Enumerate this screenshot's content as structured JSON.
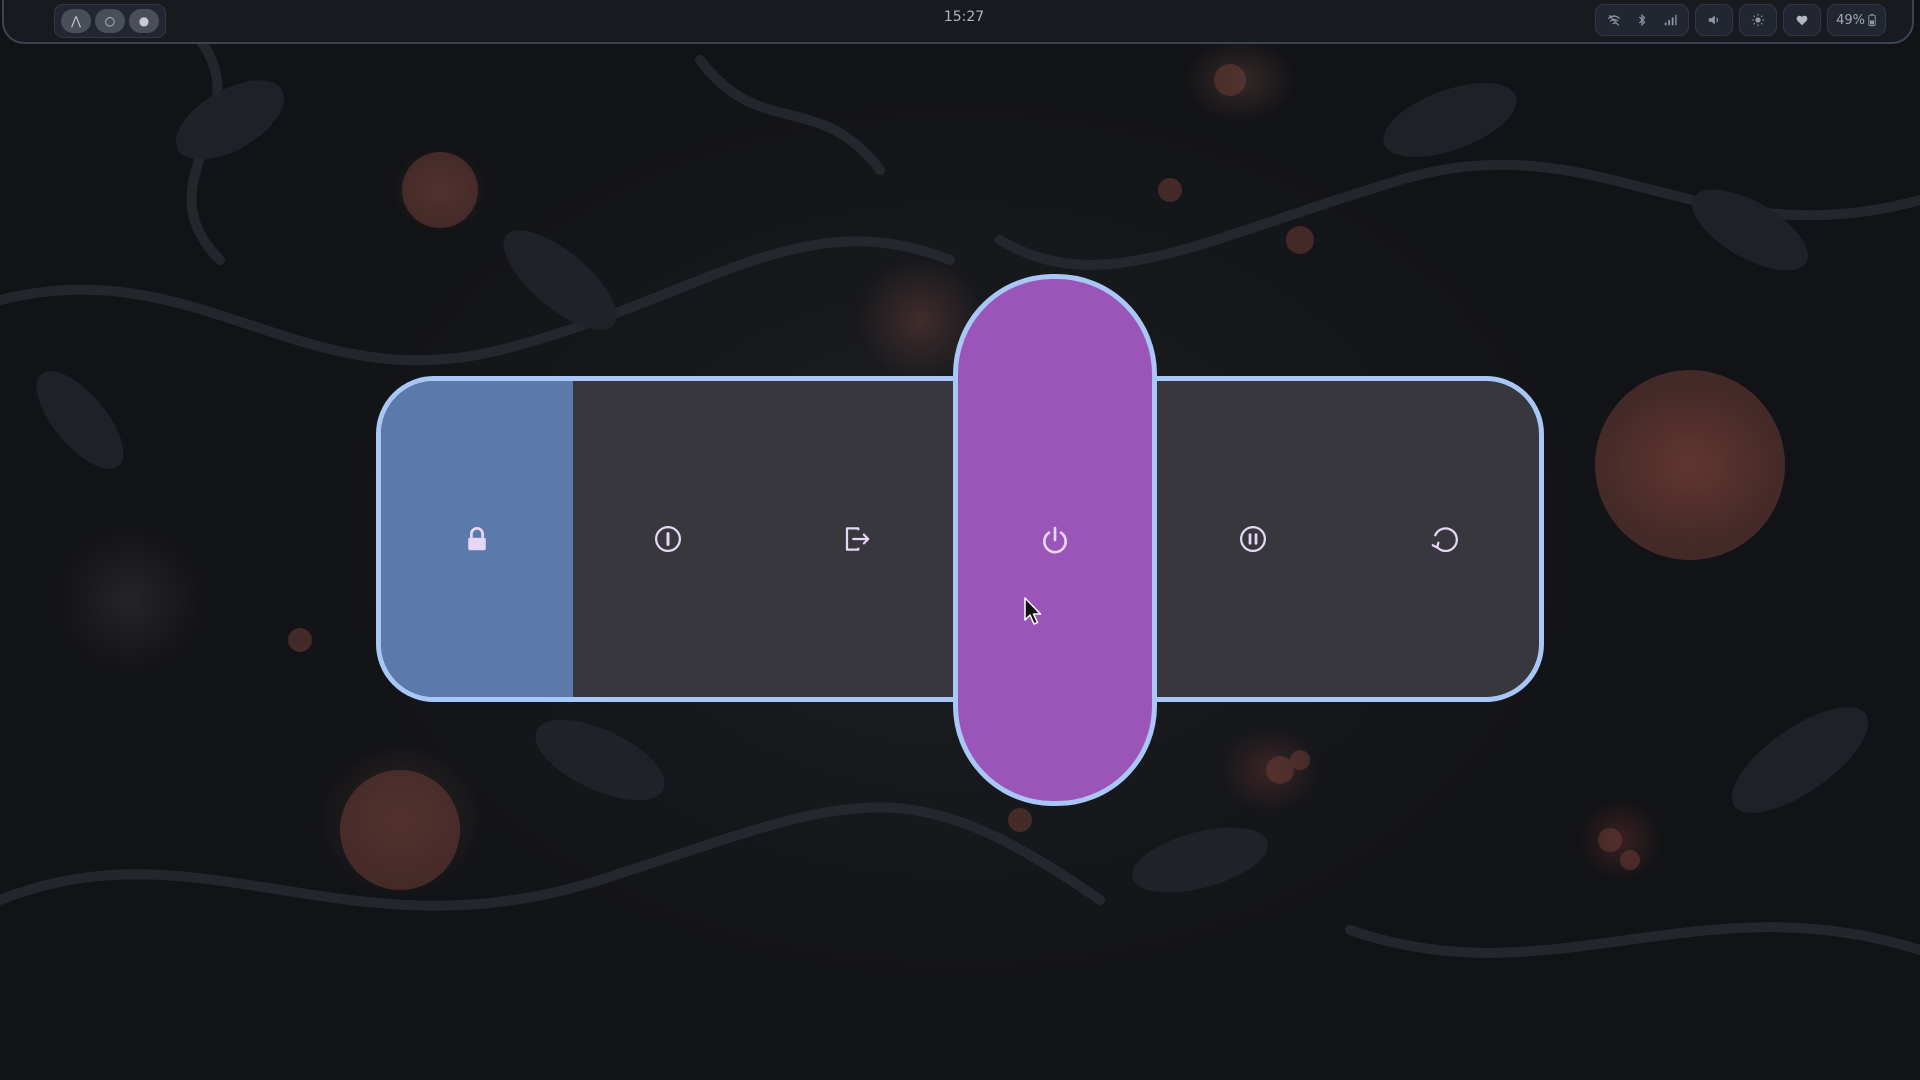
{
  "topbar": {
    "workspaces": [
      {
        "name": "arch",
        "glyph": "⋀"
      },
      {
        "name": "ws-2",
        "glyph": "○"
      },
      {
        "name": "ws-3",
        "glyph": "●"
      }
    ],
    "clock": "15:27",
    "tray": {
      "icons": [
        "wifi-off-icon",
        "bluetooth-icon",
        "signal-icon",
        "volume-icon",
        "brightness-icon",
        "heart-icon"
      ],
      "battery": "49%"
    }
  },
  "power_menu": {
    "items": [
      {
        "name": "lock",
        "icon": "lock-icon",
        "selected": true
      },
      {
        "name": "logout",
        "icon": "logout-icon"
      },
      {
        "name": "exit",
        "icon": "exit-icon"
      },
      {
        "name": "shutdown",
        "icon": "power-icon",
        "hovered": true
      },
      {
        "name": "suspend",
        "icon": "pause-icon"
      },
      {
        "name": "reboot",
        "icon": "reboot-icon"
      }
    ]
  },
  "colors": {
    "accent_border": "#a9c7f6",
    "menu_background": "#37373d",
    "selected_background": "#5b79aa",
    "hover_background": "#9b55b9",
    "icon_color": "#e6d7f5"
  }
}
